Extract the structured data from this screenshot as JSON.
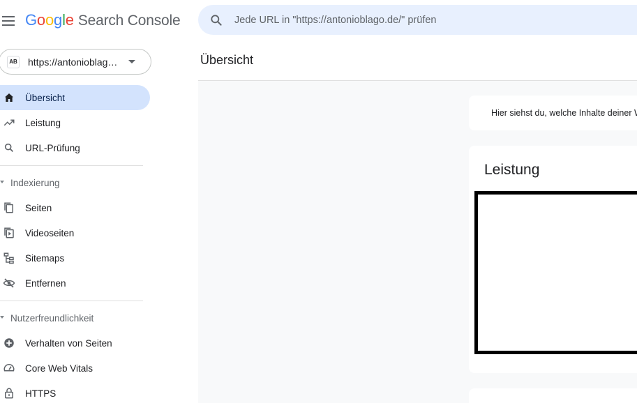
{
  "header": {
    "logo_letters": [
      "G",
      "o",
      "o",
      "g",
      "l",
      "e"
    ],
    "product_name": "Search Console",
    "search_placeholder": "Jede URL in \"https://antonioblago.de/\" prüfen"
  },
  "property": {
    "favicon_text": "AB",
    "url": "https://antonioblago.de/"
  },
  "nav": {
    "items_top": [
      {
        "label": "Übersicht",
        "icon": "home-icon",
        "active": true
      },
      {
        "label": "Leistung",
        "icon": "trending-up-icon",
        "active": false
      },
      {
        "label": "URL-Prüfung",
        "icon": "search-icon",
        "active": false
      }
    ],
    "section_indexing": "Indexierung",
    "items_indexing": [
      {
        "label": "Seiten",
        "icon": "pages-icon"
      },
      {
        "label": "Videoseiten",
        "icon": "video-pages-icon"
      },
      {
        "label": "Sitemaps",
        "icon": "sitemap-icon"
      },
      {
        "label": "Entfernen",
        "icon": "visibility-off-icon"
      }
    ],
    "section_experience": "Nutzerfreundlichkeit",
    "items_experience": [
      {
        "label": "Verhalten von Seiten",
        "icon": "add-circle-icon"
      },
      {
        "label": "Core Web Vitals",
        "icon": "speed-gauge-icon"
      },
      {
        "label": "HTTPS",
        "icon": "lock-icon"
      }
    ]
  },
  "main": {
    "page_title": "Übersicht",
    "tip_text": "Hier siehst du, welche Inhalte deiner Website",
    "performance_card_title": "Leistung"
  },
  "colors": {
    "accent_active_bg": "#d3e3fd",
    "search_bg": "#e8f0fe",
    "bulb": "#f9ab00"
  }
}
